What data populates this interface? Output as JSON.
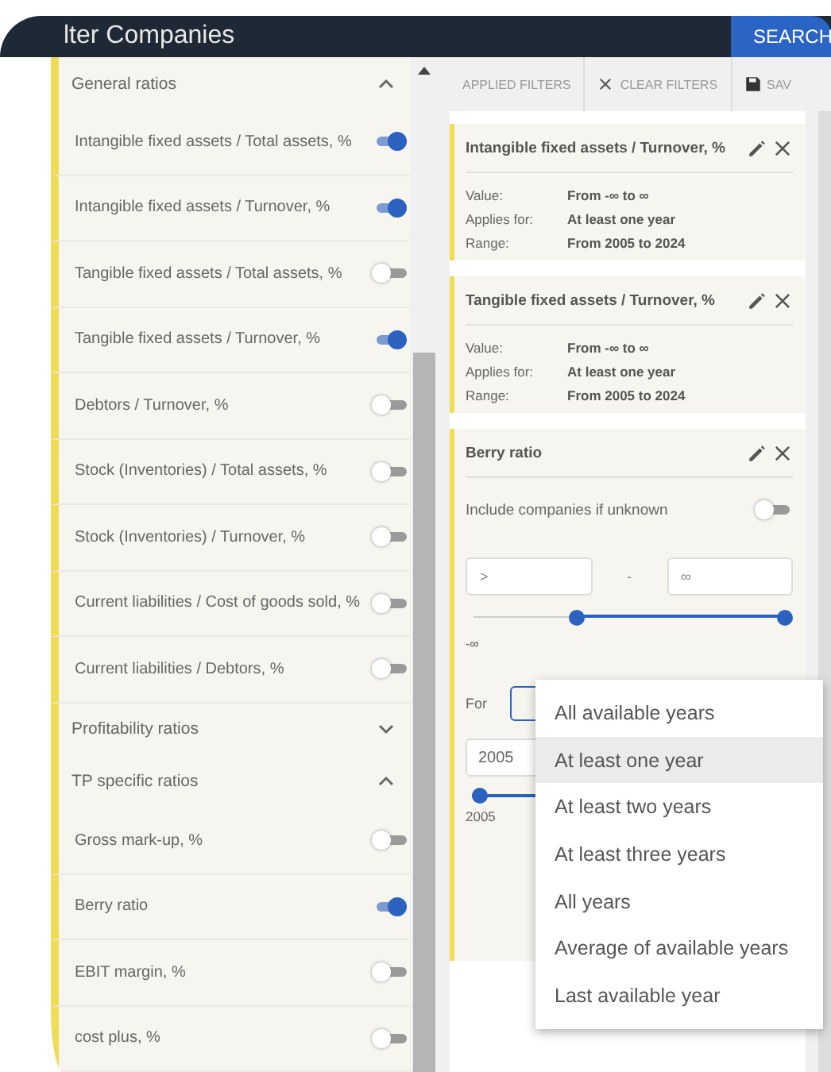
{
  "header": {
    "title": "lter Companies",
    "search_button": "SEARCH"
  },
  "groups": [
    {
      "title": "General ratios",
      "expanded": true,
      "items": [
        {
          "label": "Intangible fixed assets / Total assets, %",
          "on": true
        },
        {
          "label": "Intangible fixed assets / Turnover, %",
          "on": true
        },
        {
          "label": "Tangible fixed assets / Total assets, %",
          "on": false
        },
        {
          "label": "Tangible fixed assets / Turnover, %",
          "on": true
        },
        {
          "label": "Debtors / Turnover, %",
          "on": false
        },
        {
          "label": "Stock (Inventories) / Total assets, %",
          "on": false
        },
        {
          "label": "Stock (Inventories) / Turnover, %",
          "on": false
        },
        {
          "label": "Current liabilities / Cost of goods sold, %",
          "on": false
        },
        {
          "label": "Current liabilities / Debtors, %",
          "on": false
        }
      ]
    },
    {
      "title": "Profitability ratios",
      "expanded": false
    },
    {
      "title": "TP specific ratios",
      "expanded": true,
      "items": [
        {
          "label": "Gross mark-up, %",
          "on": false
        },
        {
          "label": "Berry ratio",
          "on": true
        },
        {
          "label": "EBIT margin, %",
          "on": false
        },
        {
          "label": "cost plus, %",
          "on": false
        }
      ]
    }
  ],
  "toolbar": {
    "applied": "APPLIED FILTERS",
    "clear": "CLEAR FILTERS",
    "save": "SAV"
  },
  "applied_filters": [
    {
      "title": "Intangible fixed assets / Turnover, %",
      "rows": [
        {
          "key": "Value:",
          "value": "From -∞ to ∞"
        },
        {
          "key": "Applies for:",
          "value": "At least one year"
        },
        {
          "key": "Range:",
          "value": "From 2005 to 2024"
        }
      ]
    },
    {
      "title": "Tangible fixed assets / Turnover, %",
      "rows": [
        {
          "key": "Value:",
          "value": "From -∞ to ∞"
        },
        {
          "key": "Applies for:",
          "value": "At least one year"
        },
        {
          "key": "Range:",
          "value": "From 2005 to 2024"
        }
      ]
    }
  ],
  "editor": {
    "title": "Berry ratio",
    "include_label": "Include companies if unknown",
    "include_on": false,
    "min_value": ">",
    "separator": "-",
    "max_value": "∞",
    "value_slider": {
      "thumbs": [
        {
          "level": 0.33
        },
        {
          "level": 1
        }
      ]
    },
    "min_label": "-∞",
    "for_label": "For",
    "year_from": "2005",
    "year_slider": {
      "level": 0
    },
    "year_label": "2005"
  },
  "dropdown": [
    {
      "label": "All available years",
      "selected": false
    },
    {
      "label": "At least one year",
      "selected": true
    },
    {
      "label": "At least two years",
      "selected": false
    },
    {
      "label": "At least three years",
      "selected": false
    },
    {
      "label": "All years",
      "selected": false
    },
    {
      "label": "Average of available years",
      "selected": false
    },
    {
      "label": "Last available year",
      "selected": false
    }
  ]
}
